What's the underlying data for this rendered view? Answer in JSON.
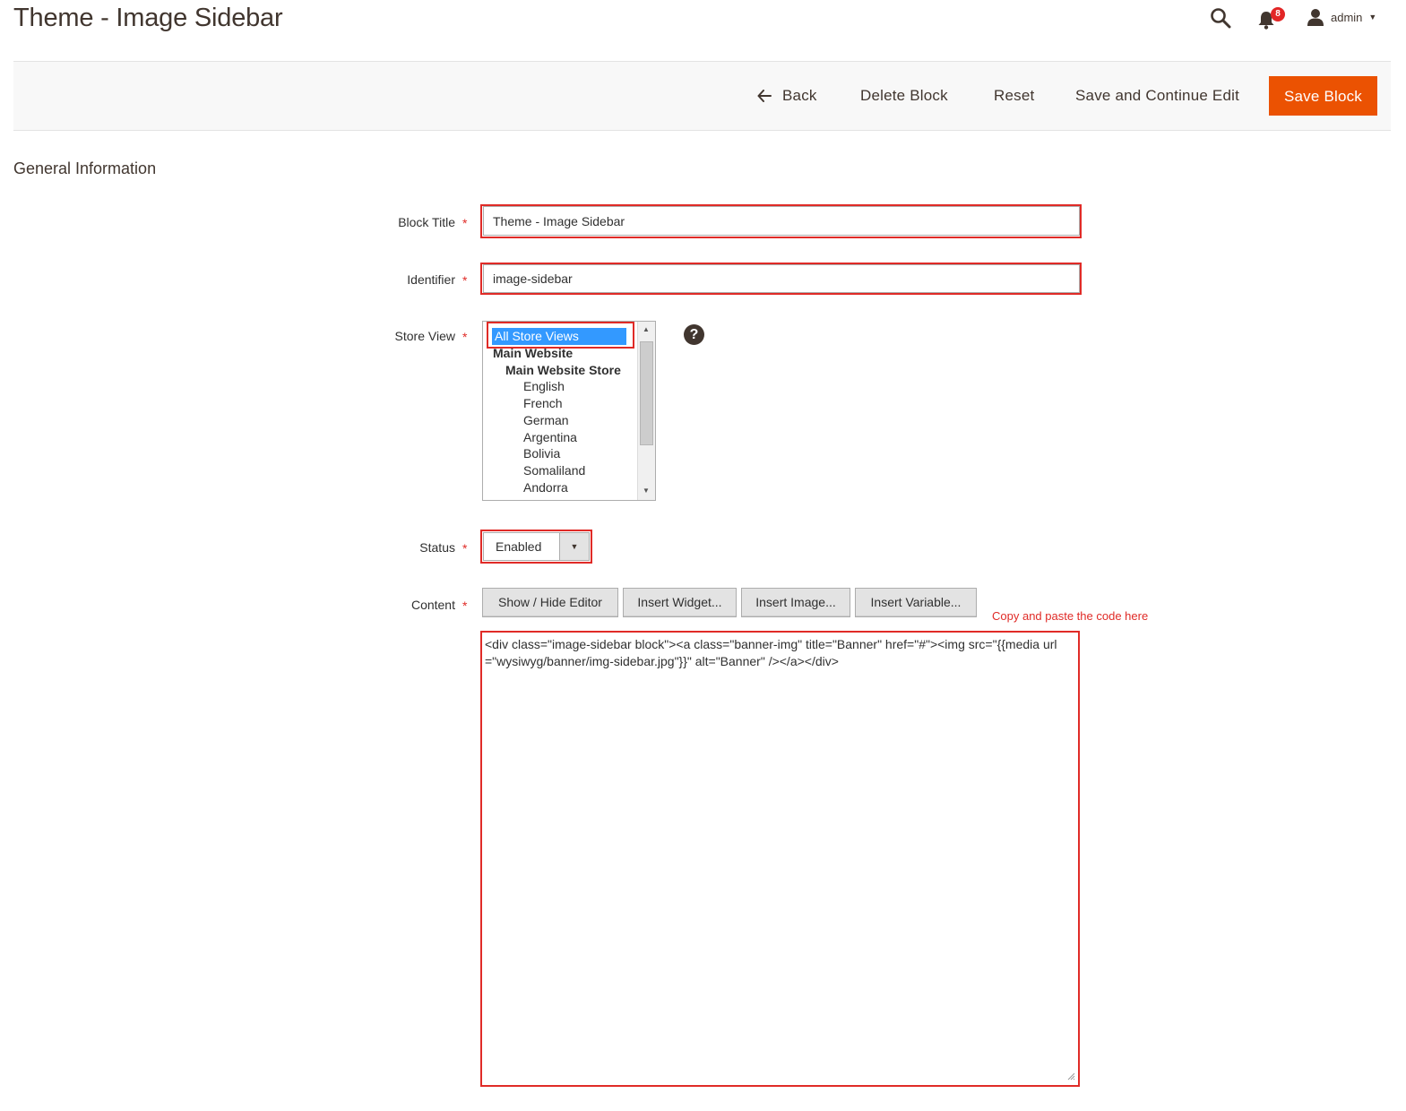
{
  "header": {
    "title": "Theme - Image Sidebar",
    "notifications_count": "8",
    "user_name": "admin",
    "icons": {
      "search": "search-icon",
      "notifications": "bell-icon",
      "user": "user-icon",
      "dropdown": "caret-down-icon"
    }
  },
  "actions": {
    "back": "Back",
    "delete": "Delete Block",
    "reset": "Reset",
    "save_continue": "Save and Continue Edit",
    "save": "Save Block"
  },
  "section": {
    "title": "General Information"
  },
  "form": {
    "block_title": {
      "label": "Block Title",
      "value": "Theme - Image Sidebar",
      "required_mark": "*"
    },
    "identifier": {
      "label": "Identifier",
      "value": "image-sidebar",
      "required_mark": "*"
    },
    "store_view": {
      "label": "Store View",
      "required_mark": "*",
      "help": "?",
      "options": [
        "All Store Views",
        "Main Website",
        "Main Website Store",
        "English",
        "French",
        "German",
        "Argentina",
        "Bolivia",
        "Somaliland",
        "Andorra"
      ],
      "selected": "All Store Views"
    },
    "status": {
      "label": "Status",
      "value": "Enabled",
      "required_mark": "*"
    },
    "content": {
      "label": "Content",
      "required_mark": "*",
      "buttons": {
        "toggle_editor": "Show / Hide Editor",
        "insert_widget": "Insert Widget...",
        "insert_image": "Insert Image...",
        "insert_variable": "Insert Variable..."
      },
      "value": "<div class=\"image-sidebar block\"><a class=\"banner-img\" title=\"Banner\" href=\"#\"><img src=\"{{media url=\"wysiwyg/banner/img-sidebar.jpg\"}}\" alt=\"Banner\" /></a></div>",
      "annotation": "Copy and paste the code here"
    }
  },
  "colors": {
    "primary_button": "#eb5202",
    "highlight": "#e02b27",
    "selection": "#3399ff"
  }
}
